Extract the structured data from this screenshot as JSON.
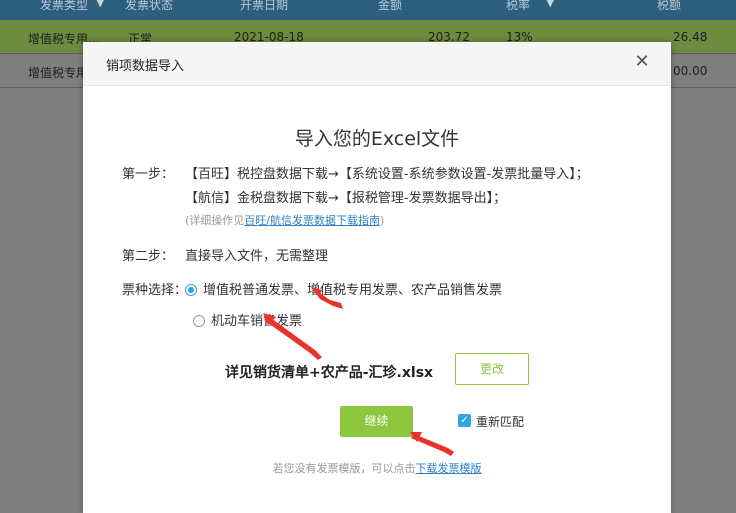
{
  "background_table": {
    "headers": [
      "发票类型",
      "发票状态",
      "开票日期",
      "金额",
      "税率",
      "税额"
    ],
    "rows": [
      {
        "type": "增值税专用...",
        "status": "正常",
        "date": "2021-08-18",
        "amount": "203.72",
        "rate": "13%",
        "tax": "26.48"
      },
      {
        "type": "增值税专用",
        "status": "",
        "date": "",
        "amount": "",
        "rate": "",
        "tax": "00.00"
      }
    ]
  },
  "modal": {
    "title": "销项数据导入",
    "heading": "导入您的Excel文件",
    "step1": {
      "label": "第一步：",
      "line1": "【百旺】税控盘数据下载→【系统设置-系统参数设置-发票批量导入】；",
      "line2": "【航信】金税盘数据下载→【报税管理-发票数据导出】；",
      "hint_prefix": "(详细操作见",
      "hint_link": "百旺/航信发票数据下载指南",
      "hint_suffix": ")"
    },
    "step2": {
      "label": "第二步：",
      "text": "直接导入文件，无需整理"
    },
    "ticket_type": {
      "label": "票种选择：",
      "options": [
        {
          "label": "增值税普通发票、增值税专用发票、农产品销售发票",
          "selected": true
        },
        {
          "label": "机动车销售发票",
          "selected": false
        }
      ]
    },
    "file_name": "详见销货清单+农产品-汇珍.xlsx",
    "change_button": "更改",
    "continue_button": "继续",
    "rematch_label": "重新匹配",
    "rematch_checked": true,
    "footer_text": "若您没有发票模版，可以点击",
    "footer_link": "下载发票模版"
  },
  "colors": {
    "accent_green": "#8dc63f",
    "accent_blue": "#2fa6e0",
    "link_blue": "#2f7fc1",
    "annotation_red": "#e8332b"
  }
}
